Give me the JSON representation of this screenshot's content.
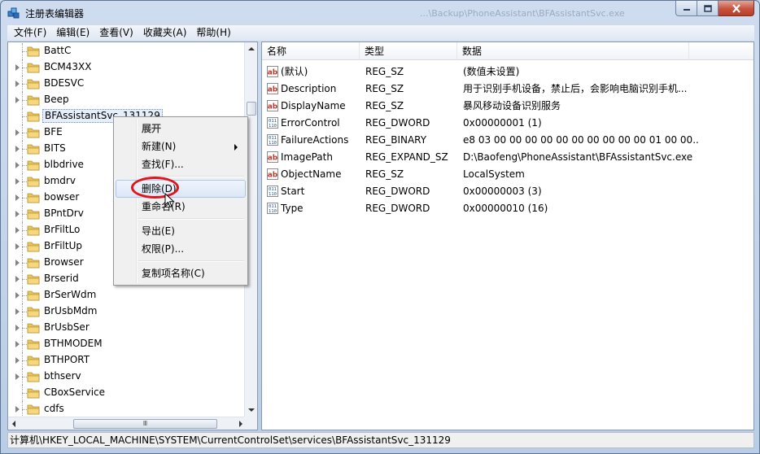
{
  "window": {
    "title": "注册表编辑器",
    "ghost_title": "...\\Backup\\PhoneAssistant\\BFAssistantSvc.exe"
  },
  "menubar": [
    "文件(F)",
    "编辑(E)",
    "查看(V)",
    "收藏夹(A)",
    "帮助(H)"
  ],
  "tree": {
    "items": [
      {
        "label": "BattC",
        "expandable": false
      },
      {
        "label": "BCM43XX",
        "expandable": true
      },
      {
        "label": "BDESVC",
        "expandable": true
      },
      {
        "label": "Beep",
        "expandable": true
      },
      {
        "label": "BFAssistantSvc_131129",
        "expandable": false,
        "selected": true
      },
      {
        "label": "BFE",
        "expandable": true
      },
      {
        "label": "BITS",
        "expandable": true
      },
      {
        "label": "blbdrive",
        "expandable": true
      },
      {
        "label": "bmdrv",
        "expandable": true
      },
      {
        "label": "bowser",
        "expandable": true
      },
      {
        "label": "BPntDrv",
        "expandable": true
      },
      {
        "label": "BrFiltLo",
        "expandable": true
      },
      {
        "label": "BrFiltUp",
        "expandable": true
      },
      {
        "label": "Browser",
        "expandable": true
      },
      {
        "label": "Brserid",
        "expandable": true
      },
      {
        "label": "BrSerWdm",
        "expandable": true
      },
      {
        "label": "BrUsbMdm",
        "expandable": true
      },
      {
        "label": "BrUsbSer",
        "expandable": true
      },
      {
        "label": "BTHMODEM",
        "expandable": true
      },
      {
        "label": "BTHPORT",
        "expandable": true
      },
      {
        "label": "bthserv",
        "expandable": true
      },
      {
        "label": "CBoxService",
        "expandable": false
      },
      {
        "label": "cdfs",
        "expandable": true
      }
    ],
    "hscroll_thumb_label": "Ⅲ"
  },
  "list": {
    "columns": [
      "名称",
      "类型",
      "数据"
    ],
    "rows": [
      {
        "name": "(默认)",
        "type": "REG_SZ",
        "data": "(数值未设置)",
        "icon": "string-value-icon"
      },
      {
        "name": "Description",
        "type": "REG_SZ",
        "data": "用于识别手机设备，禁止后，会影响电脑识别手机...",
        "icon": "string-value-icon"
      },
      {
        "name": "DisplayName",
        "type": "REG_SZ",
        "data": "暴风移动设备识别服务",
        "icon": "string-value-icon"
      },
      {
        "name": "ErrorControl",
        "type": "REG_DWORD",
        "data": "0x00000001 (1)",
        "icon": "binary-value-icon"
      },
      {
        "name": "FailureActions",
        "type": "REG_BINARY",
        "data": "e8 03 00 00 00 00 00 00 00 00 00 00 01 00 00...",
        "icon": "binary-value-icon"
      },
      {
        "name": "ImagePath",
        "type": "REG_EXPAND_SZ",
        "data": "D:\\Baofeng\\PhoneAssistant\\BFAssistantSvc.exe",
        "icon": "string-value-icon"
      },
      {
        "name": "ObjectName",
        "type": "REG_SZ",
        "data": "LocalSystem",
        "icon": "string-value-icon"
      },
      {
        "name": "Start",
        "type": "REG_DWORD",
        "data": "0x00000003 (3)",
        "icon": "binary-value-icon"
      },
      {
        "name": "Type",
        "type": "REG_DWORD",
        "data": "0x00000010 (16)",
        "icon": "binary-value-icon"
      }
    ]
  },
  "context_menu": {
    "items": [
      {
        "label": "展开",
        "bold": true
      },
      {
        "label": "新建(N)",
        "submenu": true
      },
      {
        "label": "查找(F)..."
      },
      {
        "separator": true
      },
      {
        "label": "删除(D)",
        "highlighted": true
      },
      {
        "label": "重命名(R)"
      },
      {
        "separator": true
      },
      {
        "label": "导出(E)"
      },
      {
        "label": "权限(P)..."
      },
      {
        "separator": true
      },
      {
        "label": "复制项名称(C)"
      }
    ]
  },
  "statusbar": {
    "path": "计算机\\HKEY_LOCAL_MACHINE\\SYSTEM\\CurrentControlSet\\services\\BFAssistantSvc_131129"
  },
  "colors": {
    "annotation_circle": "#e0141b",
    "folder": "#e8c25a"
  }
}
